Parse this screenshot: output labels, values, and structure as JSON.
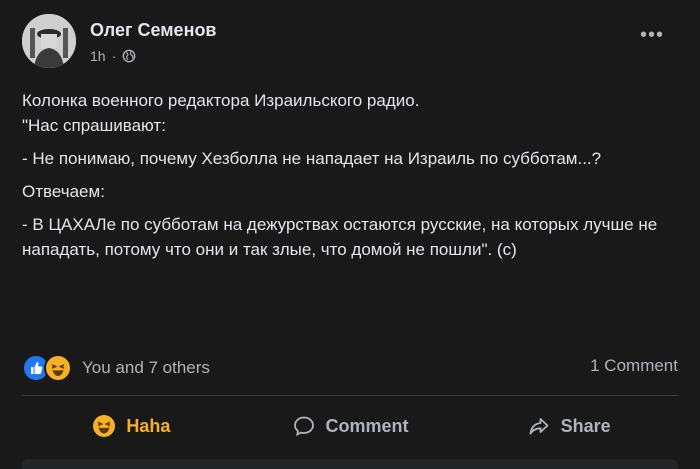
{
  "author": {
    "name": "Олег Семенов"
  },
  "meta": {
    "time": "1h",
    "separator": "·",
    "audience_icon": "globe-icon"
  },
  "menu": {
    "more_label": "•••"
  },
  "post": {
    "paragraphs": [
      "Колонка военного редактора Израильского радио.",
      "\"Нас спрашивают:",
      "- Не понимаю, почему Хезболла не нападает на Израиль по субботам...?",
      "Отвечаем:",
      "- В ЦАХАЛе по субботам на дежурствах остаются русские, на которых лучше не нападать, потому что они и так злые, что домой не пошли\". (с)"
    ]
  },
  "reactions": {
    "icons": [
      "like-icon",
      "haha-icon"
    ],
    "count_text": "You and 7 others",
    "comments_text": "1 Comment"
  },
  "actions": {
    "haha_label": "Haha",
    "comment_label": "Comment",
    "share_label": "Share"
  },
  "colors": {
    "background": "#19191a",
    "text": "#e4e6eb",
    "secondary": "#b0b3b8",
    "like": "#2078f4",
    "haha": "#f7b125"
  }
}
